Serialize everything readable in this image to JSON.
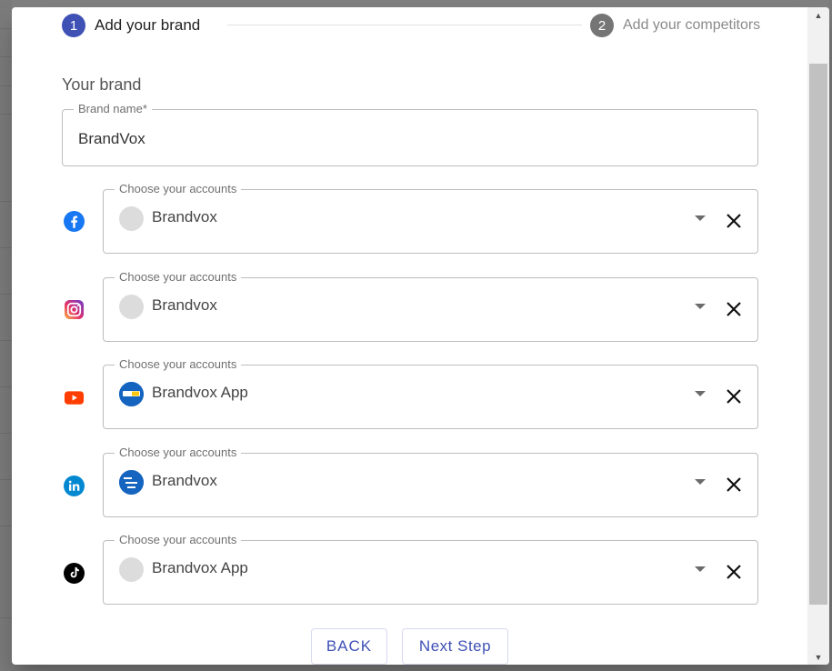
{
  "stepper": {
    "steps": [
      {
        "number": "1",
        "label": "Add your brand",
        "state": "active"
      },
      {
        "number": "2",
        "label": "Add your competitors",
        "state": "inactive"
      }
    ]
  },
  "brand_section": {
    "title": "Your brand",
    "brand_name": {
      "label": "Brand name",
      "required_mark": "*",
      "value": "BrandVox"
    }
  },
  "accounts": [
    {
      "platform": "facebook",
      "icon": "facebook-icon",
      "label": "Choose your accounts",
      "account_name": "Brandvox",
      "avatar": "placeholder"
    },
    {
      "platform": "instagram",
      "icon": "instagram-icon",
      "label": "Choose your accounts",
      "account_name": "Brandvox",
      "avatar": "placeholder"
    },
    {
      "platform": "youtube",
      "icon": "youtube-icon",
      "label": "Choose your accounts",
      "account_name": "Brandvox App",
      "avatar": "brandvox-logo"
    },
    {
      "platform": "linkedin",
      "icon": "linkedin-icon",
      "label": "Choose your accounts",
      "account_name": "Brandvox",
      "avatar": "brandvox-logo"
    },
    {
      "platform": "tiktok",
      "icon": "tiktok-icon",
      "label": "Choose your accounts",
      "account_name": "Brandvox App",
      "avatar": "placeholder"
    }
  ],
  "actions": {
    "back": "BACK",
    "next": "Next Step"
  },
  "colors": {
    "primary": "#3f51b5",
    "step_inactive": "#757575",
    "facebook": "#1877f2",
    "youtube": "#ff3d00",
    "linkedin": "#0288d1",
    "tiktok": "#000000"
  }
}
